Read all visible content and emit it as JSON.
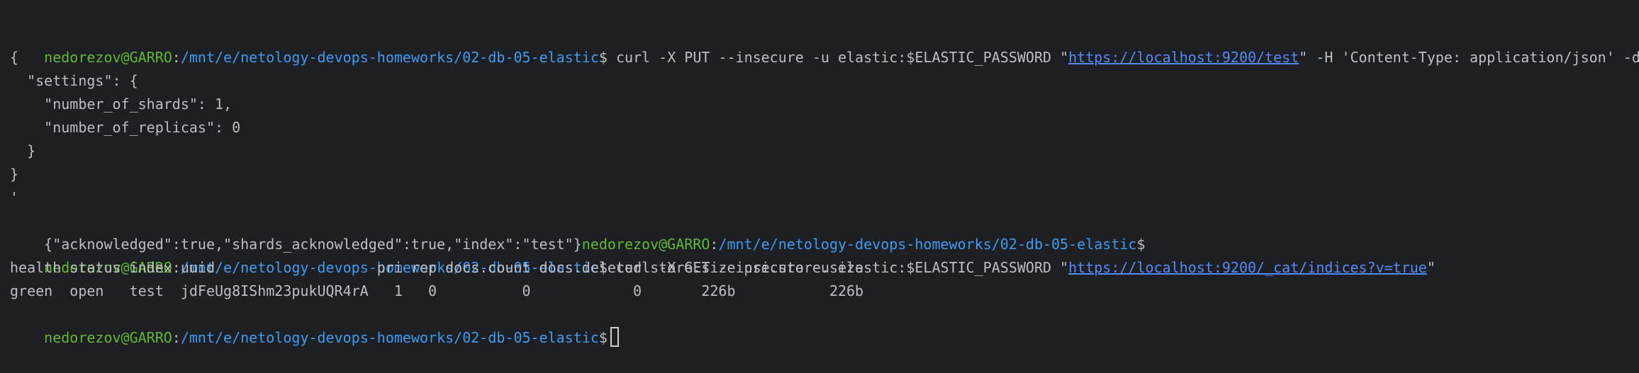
{
  "prompt": {
    "user_host": "nedorezov@GARRO",
    "separator": ":",
    "path": "/mnt/e/netology-devops-homeworks/02-db-05-elastic",
    "symbol": "$"
  },
  "commands": [
    {
      "before_url": " curl -X PUT --insecure -u elastic:$ELASTIC_PASSWORD \"",
      "url": "https://localhost:9200/test",
      "after_url": "\" -H 'Content-Type: application/json' -d'"
    },
    {
      "before_url": " curl -X GET --insecure -u elastic:$ELASTIC_PASSWORD \"",
      "url": "https://localhost:9200/_cat/indices?v=true",
      "after_url": "\""
    }
  ],
  "request_body": [
    "{",
    "  \"settings\": {",
    "    \"number_of_shards\": 1,",
    "    \"number_of_replicas\": 0",
    "  }",
    "}",
    "'"
  ],
  "put_response": "{\"acknowledged\":true,\"shards_acknowledged\":true,\"index\":\"test\"}",
  "cat_header": "health status index uuid                   pri rep docs.count docs.deleted store.size pri.store.size",
  "cat_row": "green  open   test  jdFeUg8IShm23pukUQR4rA   1   0          0            0       226b           226b"
}
